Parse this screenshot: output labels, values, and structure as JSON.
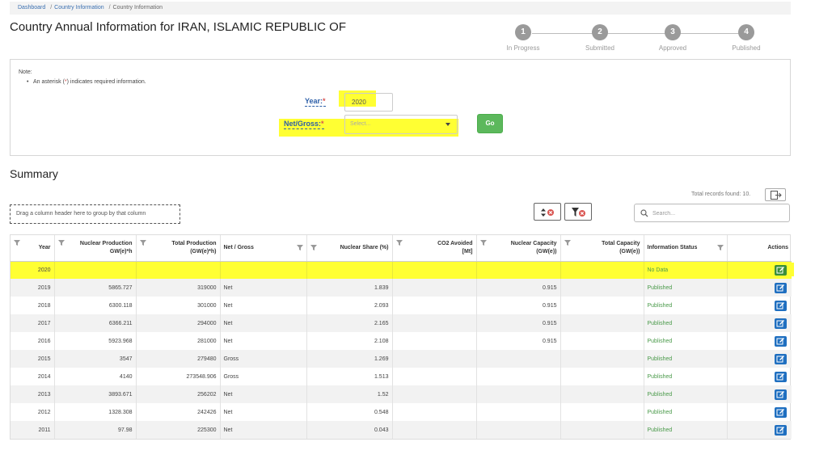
{
  "breadcrumb": {
    "items": [
      "Dashboard",
      "Country Information",
      "Country Information"
    ]
  },
  "page_title": "Country Annual Information for IRAN, ISLAMIC REPUBLIC OF",
  "stepper": [
    {
      "num": "1",
      "label": "In Progress"
    },
    {
      "num": "2",
      "label": "Submitted"
    },
    {
      "num": "3",
      "label": "Approved"
    },
    {
      "num": "4",
      "label": "Published"
    }
  ],
  "note": {
    "title": "Note:",
    "text_before": "An asterisk (",
    "asterisk": "*",
    "text_after": ") indicates required information."
  },
  "form": {
    "year_label": "Year:",
    "year_value": "2020",
    "net_gross_label": "Net/Gross:",
    "required_mark": "*",
    "select_placeholder": "Select...",
    "go_label": "Go"
  },
  "summary": {
    "title": "Summary",
    "total_records": "Total records found: 10.",
    "group_placeholder": "Drag a column header here to group by that column",
    "search_placeholder": "Search..."
  },
  "table": {
    "columns": [
      "Year",
      "Nuclear Production GW(e)*h",
      "Total Production (GW(e)*h)",
      "Net / Gross",
      "Nuclear Share (%)",
      "CO2 Avoided [Mt]",
      "Nuclear Capacity (GW(e))",
      "Total Capacity (GW(e))",
      "Information Status",
      "Actions"
    ],
    "rows": [
      {
        "year": "2020",
        "nuc_prod": "",
        "total_prod": "",
        "net_gross": "",
        "share": "",
        "co2": "",
        "nuc_cap": "",
        "total_cap": "",
        "status": "No Data"
      },
      {
        "year": "2019",
        "nuc_prod": "5865.727",
        "total_prod": "319000",
        "net_gross": "Net",
        "share": "1.839",
        "co2": "",
        "nuc_cap": "0.915",
        "total_cap": "",
        "status": "Published"
      },
      {
        "year": "2018",
        "nuc_prod": "6300.118",
        "total_prod": "301000",
        "net_gross": "Net",
        "share": "2.093",
        "co2": "",
        "nuc_cap": "0.915",
        "total_cap": "",
        "status": "Published"
      },
      {
        "year": "2017",
        "nuc_prod": "6366.211",
        "total_prod": "294000",
        "net_gross": "Net",
        "share": "2.165",
        "co2": "",
        "nuc_cap": "0.915",
        "total_cap": "",
        "status": "Published"
      },
      {
        "year": "2016",
        "nuc_prod": "5923.968",
        "total_prod": "281000",
        "net_gross": "Net",
        "share": "2.108",
        "co2": "",
        "nuc_cap": "0.915",
        "total_cap": "",
        "status": "Published"
      },
      {
        "year": "2015",
        "nuc_prod": "3547",
        "total_prod": "279480",
        "net_gross": "Gross",
        "share": "1.269",
        "co2": "",
        "nuc_cap": "",
        "total_cap": "",
        "status": "Published"
      },
      {
        "year": "2014",
        "nuc_prod": "4140",
        "total_prod": "273548.906",
        "net_gross": "Gross",
        "share": "1.513",
        "co2": "",
        "nuc_cap": "",
        "total_cap": "",
        "status": "Published"
      },
      {
        "year": "2013",
        "nuc_prod": "3893.671",
        "total_prod": "256202",
        "net_gross": "Net",
        "share": "1.52",
        "co2": "",
        "nuc_cap": "",
        "total_cap": "",
        "status": "Published"
      },
      {
        "year": "2012",
        "nuc_prod": "1328.308",
        "total_prod": "242426",
        "net_gross": "Net",
        "share": "0.548",
        "co2": "",
        "nuc_cap": "",
        "total_cap": "",
        "status": "Published"
      },
      {
        "year": "2011",
        "nuc_prod": "97.98",
        "total_prod": "225300",
        "net_gross": "Net",
        "share": "0.043",
        "co2": "",
        "nuc_cap": "",
        "total_cap": "",
        "status": "Published"
      }
    ]
  },
  "colors": {
    "link": "#3a6fb0",
    "highlight": "#ffff33",
    "go": "#5cb85c",
    "edit": "#1f6fc0",
    "status": "#4a9a4a",
    "required": "#d9534f"
  }
}
